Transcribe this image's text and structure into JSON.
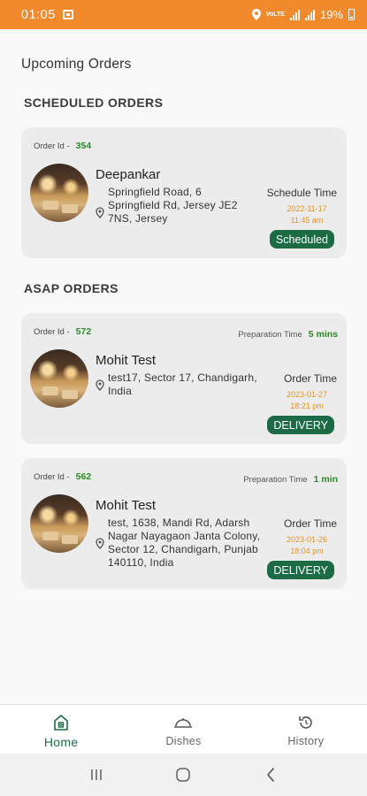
{
  "status_bar": {
    "time": "01:05",
    "network": "VoLTE",
    "battery": "19%"
  },
  "header": {
    "title": "Upcoming Orders"
  },
  "sections": {
    "scheduled_title": "SCHEDULED ORDERS",
    "asap_title": "ASAP ORDERS"
  },
  "orders": [
    {
      "id_label": "Order Id -",
      "id": "354",
      "customer": "Deepankar",
      "address_line1": "Springfield Road, 6",
      "address_rest": "Springfield Rd, Jersey JE2 7NS, Jersey",
      "time_label": "Schedule Time",
      "date": "2022-11-17",
      "time": "11:45 am",
      "badge": "Scheduled"
    },
    {
      "id_label": "Order Id -",
      "id": "572",
      "prep_label": "Preparation Time",
      "prep_value": "5 mins",
      "customer": "Mohit Test",
      "address": "test17, Sector 17, Chandigarh, India",
      "time_label": "Order Time",
      "date": "2023-01-27",
      "time": "18:21 pm",
      "badge": "DELIVERY"
    },
    {
      "id_label": "Order Id -",
      "id": "562",
      "prep_label": "Preparation Time",
      "prep_value": "1 min",
      "customer": "Mohit Test",
      "address": "test, 1638, Mandi Rd, Adarsh Nagar Nayagaon Janta Colony, Sector 12, Chandigarh, Punjab 140110, India",
      "time_label": "Order Time",
      "date": "2023-01-26",
      "time": "18:04 pm",
      "badge": "DELIVERY"
    }
  ],
  "bottom_nav": [
    {
      "label": "Home",
      "icon": "home-icon",
      "active": true
    },
    {
      "label": "Dishes",
      "icon": "dish-cloche-icon",
      "active": false
    },
    {
      "label": "History",
      "icon": "history-icon",
      "active": false
    }
  ],
  "colors": {
    "status_bar": "#f08a2c",
    "accent_green": "#1d6b45",
    "id_green": "#2b8a2b",
    "time_orange": "#e39422",
    "card_bg": "#ececec"
  }
}
